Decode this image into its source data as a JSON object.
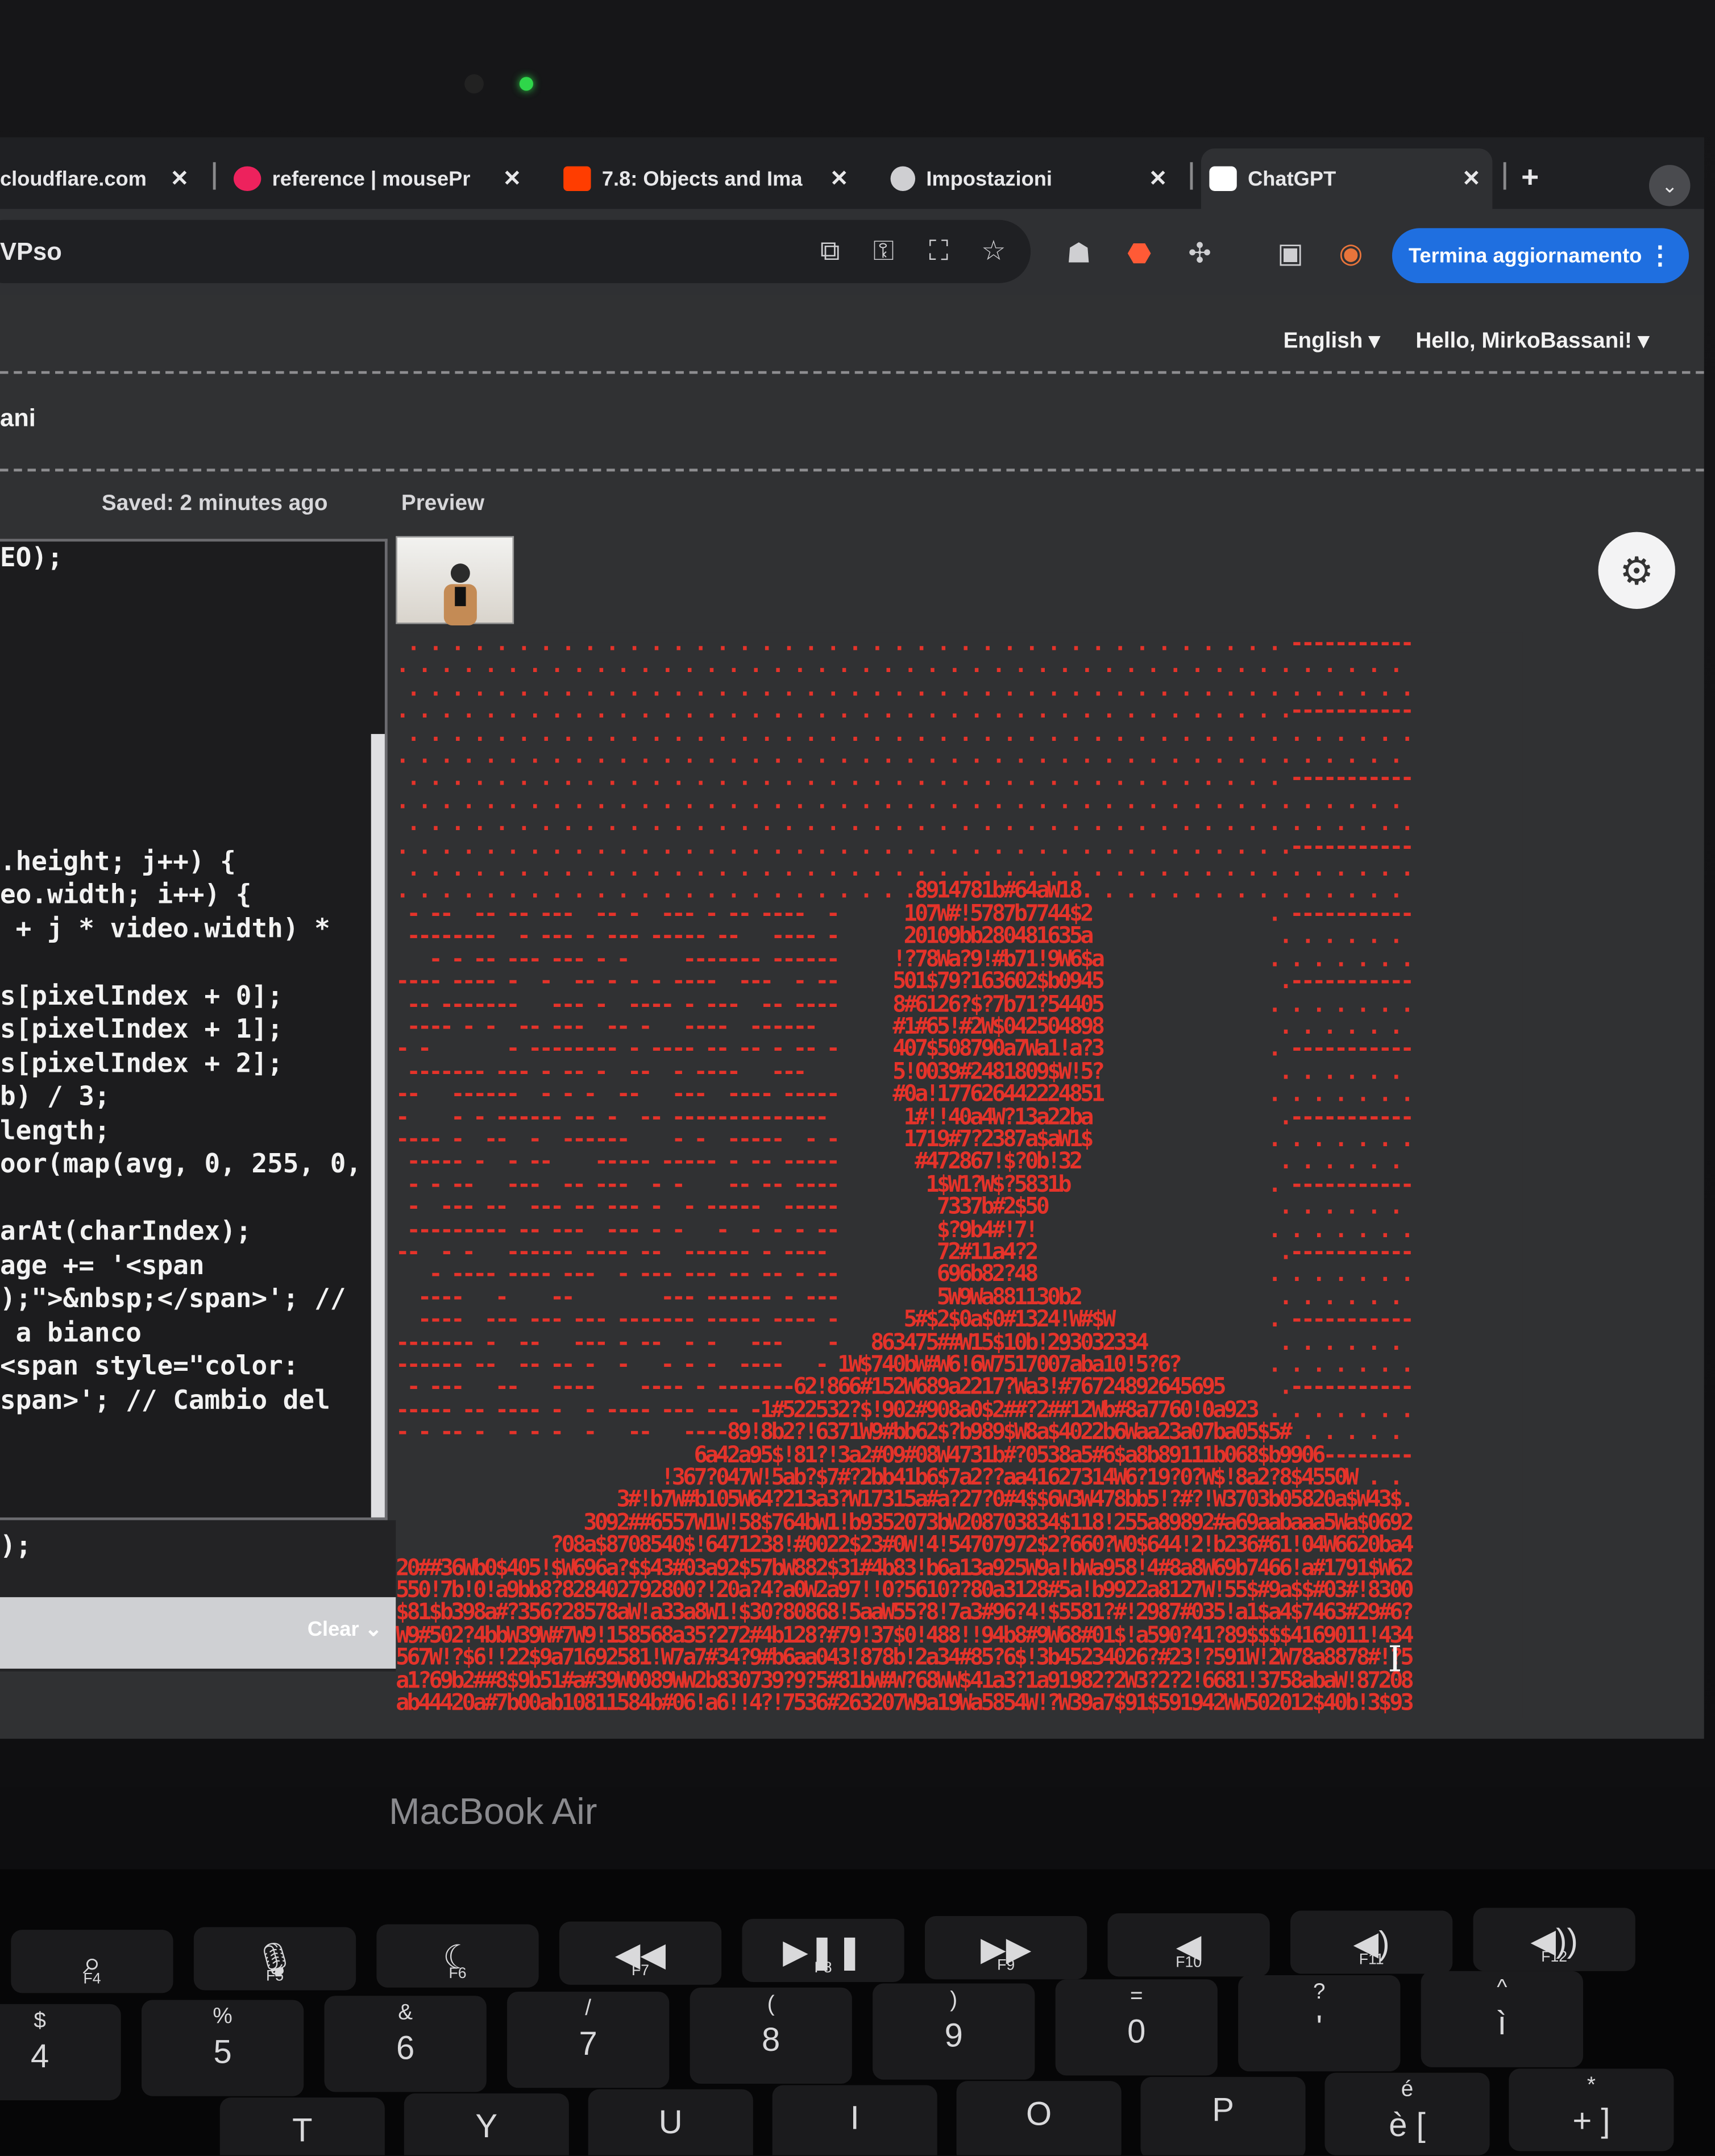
{
  "browser": {
    "tabs": [
      {
        "label": "cloudflare.com",
        "close": "✕",
        "favicon_color": "#f48120"
      },
      {
        "label": "reference | mousePr",
        "close": "✕",
        "favicon_color": "#ed225d"
      },
      {
        "label": "7.8: Objects and Ima",
        "close": "✕",
        "favicon_color": "#ff3d00"
      },
      {
        "label": "Impostazioni",
        "close": "✕",
        "favicon_color": "#cfcfd2"
      },
      {
        "label": "ChatGPT",
        "close": "✕",
        "favicon_color": "#ffffff"
      }
    ],
    "new_tab": "+",
    "address_fragment": "VPso",
    "update_button": "Termina aggiornamento",
    "accent": "#1f6fe0"
  },
  "editor_page": {
    "language": "English",
    "greeting": "Hello, MirkoBassani!",
    "sketch_name_fragment": "ani",
    "saved_status": "Saved: 2 minutes ago",
    "preview_label": "Preview",
    "code_lines": [
      "EO);",
      "",
      "",
      "",
      "",
      "",
      "",
      "",
      "",
      ".height; j++) {",
      "eo.width; i++) {",
      " + j * video.width) *",
      "",
      "s[pixelIndex + 0];",
      "s[pixelIndex + 1];",
      "s[pixelIndex + 2];",
      "b) / 3;",
      "length;",
      "oor(map(avg, 0, 255, 0,",
      "",
      "arAt(charIndex);",
      "age += '<span",
      ");\">&nbsp;</span>'; //",
      " a bianco",
      "<span style=\"color: ",
      "span>'; // Cambio del"
    ],
    "console_text": ");",
    "clear_label": "Clear",
    "ascii_color": "#e5332a"
  },
  "device": {
    "brand": "MacBook Air",
    "keys_fn": [
      {
        "t": "",
        "b": "F4",
        "m": "⌕"
      },
      {
        "t": "",
        "b": "F5",
        "m": "🎙"
      },
      {
        "t": "",
        "b": "F6",
        "m": "☾"
      },
      {
        "t": "",
        "b": "F7",
        "m": "◀◀"
      },
      {
        "t": "",
        "b": "F8",
        "m": "▶❚❚"
      },
      {
        "t": "",
        "b": "F9",
        "m": "▶▶"
      },
      {
        "t": "",
        "b": "F10",
        "m": "◀"
      },
      {
        "t": "",
        "b": "F11",
        "m": "◀)"
      },
      {
        "t": "",
        "b": "F12",
        "m": "◀))"
      }
    ],
    "keys_num": [
      {
        "t": "$",
        "m": "4"
      },
      {
        "t": "%",
        "m": "5"
      },
      {
        "t": "&",
        "m": "6"
      },
      {
        "t": "/",
        "m": "7"
      },
      {
        "t": "(",
        "m": "8"
      },
      {
        "t": ")",
        "m": "9"
      },
      {
        "t": "=",
        "m": "0"
      },
      {
        "t": "?",
        "m": "'"
      },
      {
        "t": "^",
        "m": "ì"
      }
    ],
    "keys_letter": [
      {
        "m": "T"
      },
      {
        "m": "Y"
      },
      {
        "m": "U"
      },
      {
        "m": "I"
      },
      {
        "m": "O"
      },
      {
        "m": "P"
      },
      {
        "t": "é",
        "m": "è ["
      },
      {
        "t": "*",
        "m": "+ ]"
      }
    ]
  }
}
